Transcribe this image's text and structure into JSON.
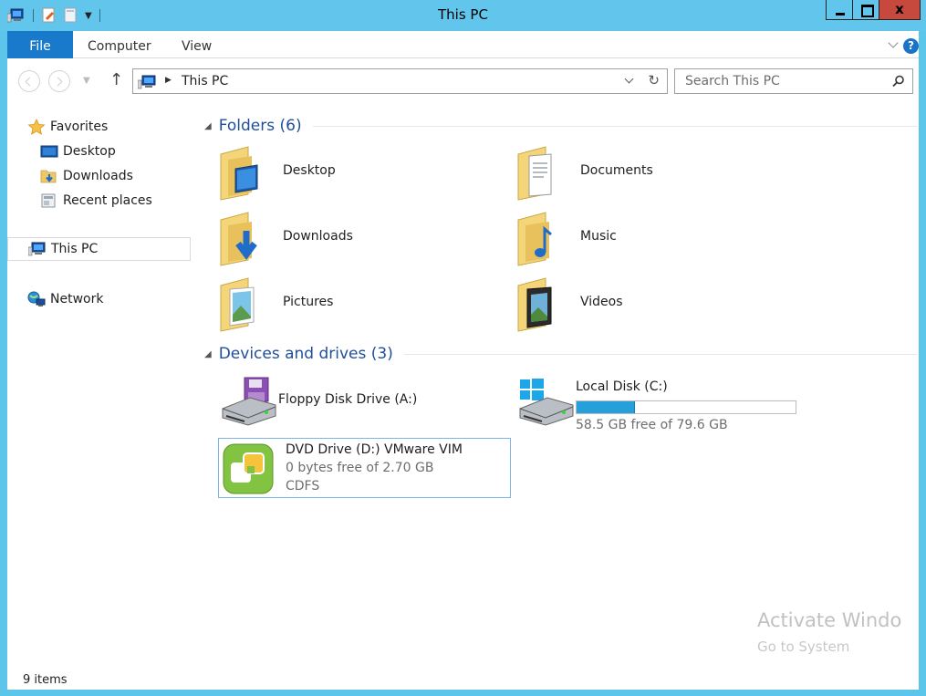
{
  "window": {
    "title": "This PC",
    "accent_color": "#5bc5ea",
    "close_color": "#c7493d"
  },
  "ribbon": {
    "tabs": [
      "File",
      "Computer",
      "View"
    ],
    "help": "?"
  },
  "navigation": {
    "address_path": "This PC",
    "search_placeholder": "Search This PC"
  },
  "sidebar": {
    "favorites_label": "Favorites",
    "favorites": [
      "Desktop",
      "Downloads",
      "Recent places"
    ],
    "this_pc_label": "This PC",
    "network_label": "Network"
  },
  "folders": {
    "heading": "Folders (6)",
    "items": [
      "Desktop",
      "Documents",
      "Downloads",
      "Music",
      "Pictures",
      "Videos"
    ]
  },
  "devices": {
    "heading": "Devices and drives (3)",
    "floppy": {
      "name": "Floppy Disk Drive (A:)"
    },
    "local_disk": {
      "name": "Local Disk (C:)",
      "free_text": "58.5 GB free of 79.6 GB",
      "used_fraction": 0.265,
      "bar_color": "#26a0da"
    },
    "dvd": {
      "name": "DVD Drive (D:) VMware VIM",
      "free_text": "0 bytes free of 2.70 GB",
      "filesystem": "CDFS"
    }
  },
  "status": {
    "item_count": "9 items"
  },
  "watermark": {
    "line1": "Activate Windo",
    "line2": "Go to System"
  }
}
